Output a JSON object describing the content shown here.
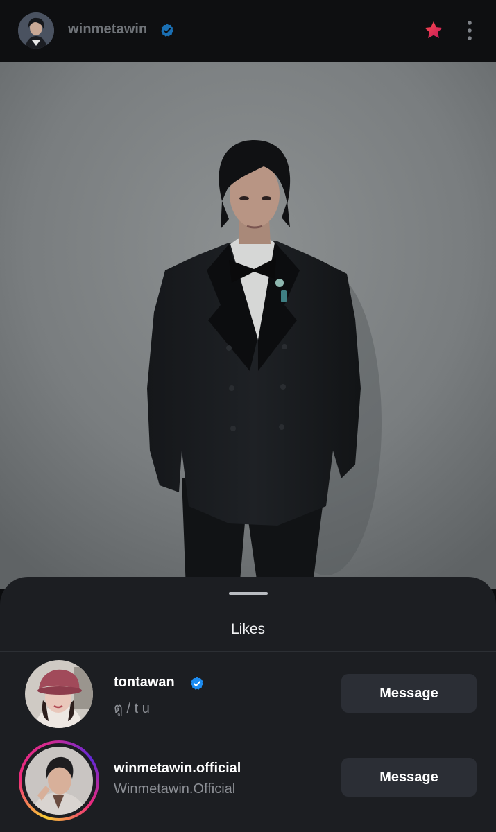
{
  "header": {
    "username": "winmetawin",
    "avatar_icon": "profile-avatar",
    "verified_icon": "verified-badge-icon",
    "favorite_icon": "star-icon",
    "more_icon": "more-vertical-icon",
    "accent_color": "#e8373a"
  },
  "post": {
    "image_icon": "post-photo"
  },
  "likes_sheet": {
    "title": "Likes",
    "items": [
      {
        "username": "tontawan",
        "subtitle": "ตู / t u",
        "verified": true,
        "has_story_ring": false,
        "button_label": "Message"
      },
      {
        "username": "winmetawin.official",
        "subtitle": "Winmetawin.Official",
        "verified": false,
        "has_story_ring": true,
        "button_label": "Message"
      }
    ],
    "verified_color": "#1d8cf0",
    "button_color": "#2b2e35"
  }
}
